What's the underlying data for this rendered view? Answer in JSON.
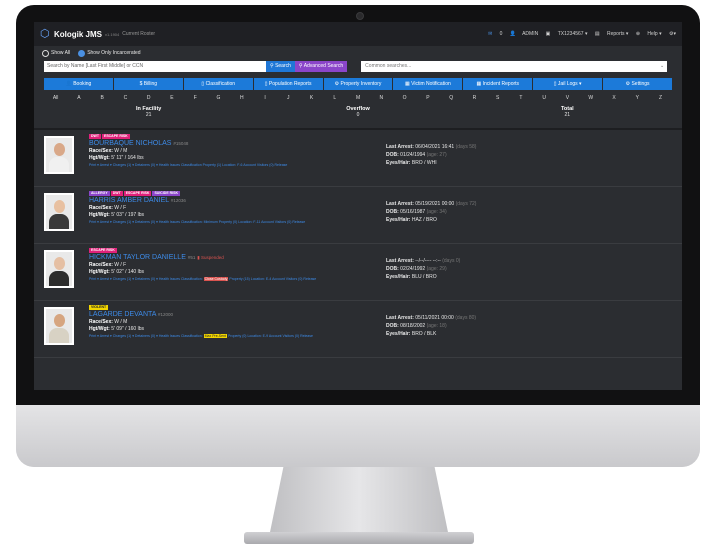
{
  "app": {
    "brand": "Kologik JMS",
    "version": "v1.1904",
    "view": "Current Roster"
  },
  "topnav": {
    "alert": "0",
    "user": "ADMIN",
    "booking_id": "TX1234567",
    "reports": "Reports",
    "help": "Help"
  },
  "filters": {
    "show_all": "Show All",
    "show_incarcerated": "Show Only Incarcerated"
  },
  "search": {
    "placeholder": "Search by Name [Last First Middle] or CCN",
    "search_label": "Search",
    "advanced_label": "Advanced Search",
    "common_placeholder": "Common searches..."
  },
  "menu": [
    "Booking",
    "Billing",
    "Classification",
    "Population Reports",
    "Property Inventory",
    "Victim Notification",
    "Incident Reports",
    "Jail Logs",
    "Settings"
  ],
  "alphabet": [
    "All",
    "A",
    "B",
    "C",
    "D",
    "E",
    "F",
    "G",
    "H",
    "I",
    "J",
    "K",
    "L",
    "M",
    "N",
    "O",
    "P",
    "Q",
    "R",
    "S",
    "T",
    "U",
    "V",
    "W",
    "X",
    "Y",
    "Z"
  ],
  "counts": {
    "in_facility_label": "In Facility",
    "in_facility": "21",
    "overflow_label": "Overflow",
    "overflow": "0",
    "total_label": "Total",
    "total": "21"
  },
  "inmates": [
    {
      "badges": [
        "DWT",
        "ESCAPE RISK"
      ],
      "name": "BOURBAQUE NICHOLAS",
      "booking": "#15048",
      "race_sex": "W / M",
      "hgt_wgt": "5' 11\" / 164 lbs",
      "last_arrest": "06/04/2021 16:41",
      "days": "(days 58)",
      "dob": "01/24/1994",
      "age": "(age: 27)",
      "eyes_hair": "BRO / WHI"
    },
    {
      "badges": [
        "ALLERGY",
        "DWT",
        "ESCAPE RISK",
        "SUICIDE RISK"
      ],
      "name": "HARRIS AMBER DANIEL",
      "booking": "#12036",
      "race_sex": "W / F",
      "hgt_wgt": "5' 03\" / 197 lbs",
      "last_arrest": "05/19/2021 00:00",
      "days": "(days 72)",
      "dob": "05/16/1987",
      "age": "(age: 34)",
      "eyes_hair": "HAZ / BRO"
    },
    {
      "badges": [
        "ESCAPE RISK"
      ],
      "name": "HICKMAN TAYLOR DANIELLE",
      "booking": "#51",
      "suspended": "Suspended",
      "race_sex": "W / F",
      "hgt_wgt": "5' 02\" / 140 lbs",
      "last_arrest": "--/--/---- --:--",
      "days": "(days 0)",
      "dob": "02/24/1992",
      "age": "(age: 29)",
      "eyes_hair": "BLU / BRO"
    },
    {
      "badges": [
        "VIOLENT"
      ],
      "name": "LAGARDE DEVANTA",
      "booking": "#12000",
      "race_sex": "W / M",
      "hgt_wgt": "5' 09\" / 160 lbs",
      "last_arrest": "05/11/2021 00:00",
      "days": "(days 80)",
      "dob": "08/18/2002",
      "age": "(age: 18)",
      "eyes_hair": "BRO / BLK"
    }
  ],
  "labels": {
    "race_sex": "Race/Sex:",
    "hgt_wgt": "Hgt/Wgt:",
    "last_arrest": "Last Arrest:",
    "dob": "DOB:",
    "eyes_hair": "Eyes/Hair:"
  },
  "row_links": {
    "r1": "Print ▾   Arrest ▾   Charges (1) ▾   Detainers (0) ▾   Health Issues   Classification   Property (1)   Location: F-6   Account   Visitors (0)   Release",
    "r2": "Print ▾   Arrest ▾   Charges (1) ▾   Detainers (0) ▾   Health Issues   Classification: Minimum   Property (0)   Location: F-11   Account   Visitors (0)   Release",
    "r3a": "Print ▾   Arrest ▾   Charges (1) ▾   Detainers (0) ▾   Health Issues   Classification:",
    "r3tag": "Close Custody",
    "r3b": "Property (15)   Location: E-4   Account   Visitors (0)   Release",
    "r4a": "Print ▾   Arrest ▾   Charges (1) ▾   Detainers (0) ▾   Health Issues   Classification:",
    "r4tag": "Max Pre-Sent",
    "r4b": "Property (0)   Location: E-9   Account   Visitors (0)   Release"
  },
  "colors": {
    "accent": "#1c7ad9",
    "link": "#3d8be8",
    "bg": "#2b2d31"
  }
}
